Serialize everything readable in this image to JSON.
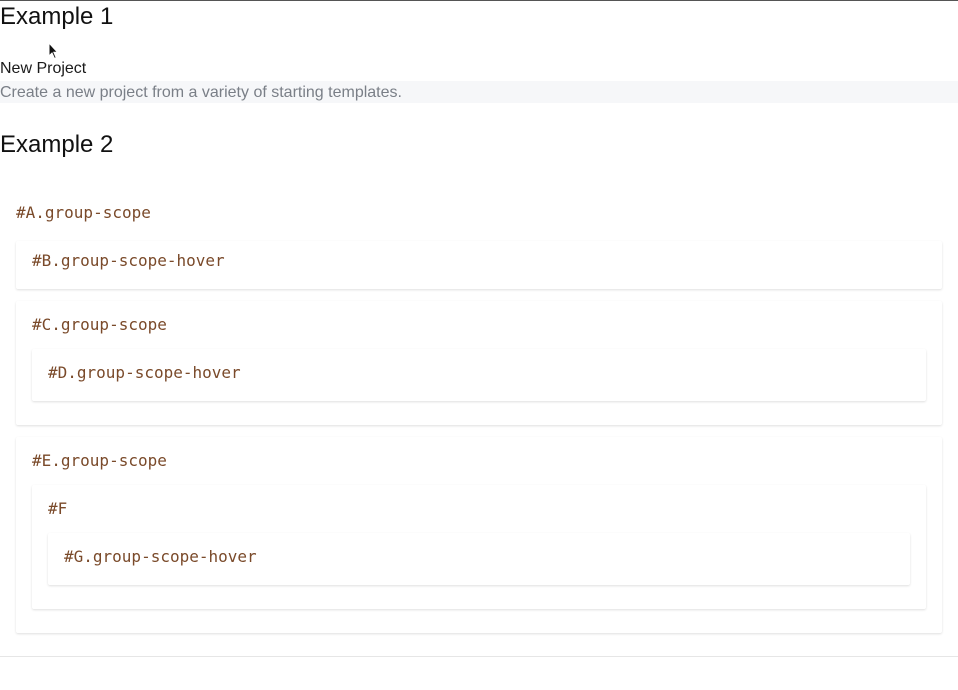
{
  "example1": {
    "heading": "Example 1",
    "project_title": "New Project",
    "project_description": "Create a new project from a variety of starting templates."
  },
  "example2": {
    "heading": "Example 2",
    "boxes": {
      "a": "#A.group-scope",
      "b": "#B.group-scope-hover",
      "c": "#C.group-scope",
      "d": "#D.group-scope-hover",
      "e": "#E.group-scope",
      "f": "#F",
      "g": "#G.group-scope-hover"
    }
  },
  "cursor": {
    "icon": "mouse-pointer-icon"
  },
  "colors": {
    "label_text": "#7a4a2a",
    "description_text": "#7a7f87",
    "description_bg": "#f6f7f9"
  }
}
